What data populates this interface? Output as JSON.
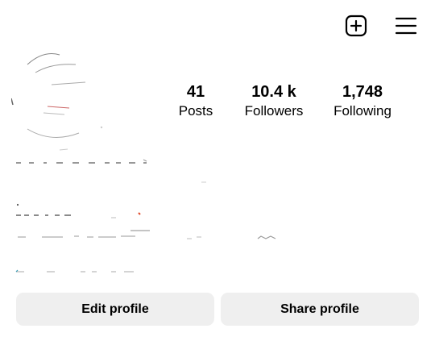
{
  "header": {
    "new_post_icon": "plus-square-icon",
    "menu_icon": "hamburger-menu-icon"
  },
  "profile": {
    "avatar": "redacted-profile-photo"
  },
  "stats": {
    "posts": {
      "value": "41",
      "label": "Posts"
    },
    "followers": {
      "value": "10.4 k",
      "label": "Followers"
    },
    "following": {
      "value": "1,748",
      "label": "Following"
    }
  },
  "bio": {
    "status": "redacted"
  },
  "buttons": {
    "edit_profile": "Edit profile",
    "share_profile": "Share profile"
  },
  "colors": {
    "button_bg": "#efefef",
    "text": "#000000",
    "background": "#ffffff"
  }
}
